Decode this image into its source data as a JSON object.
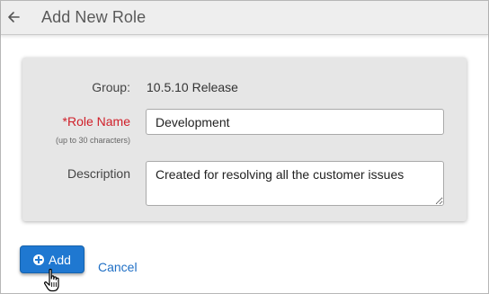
{
  "header": {
    "title": "Add New Role",
    "back_icon": "arrow-left-icon"
  },
  "form": {
    "group_label": "Group:",
    "group_value": "10.5.10 Release",
    "role_name_label": "*Role Name",
    "role_name_hint": "(up to 30 characters)",
    "role_name_value": "Development",
    "description_label": "Description",
    "description_value": "Created for resolving all the customer issues"
  },
  "actions": {
    "add_label": "Add",
    "add_icon": "plus-circle-icon",
    "cancel_label": "Cancel"
  },
  "colors": {
    "primary": "#1f78d1",
    "required": "#d0202a",
    "link": "#1f6fc5",
    "card_bg": "#e6e6e6",
    "header_bg": "#eeeeee"
  }
}
